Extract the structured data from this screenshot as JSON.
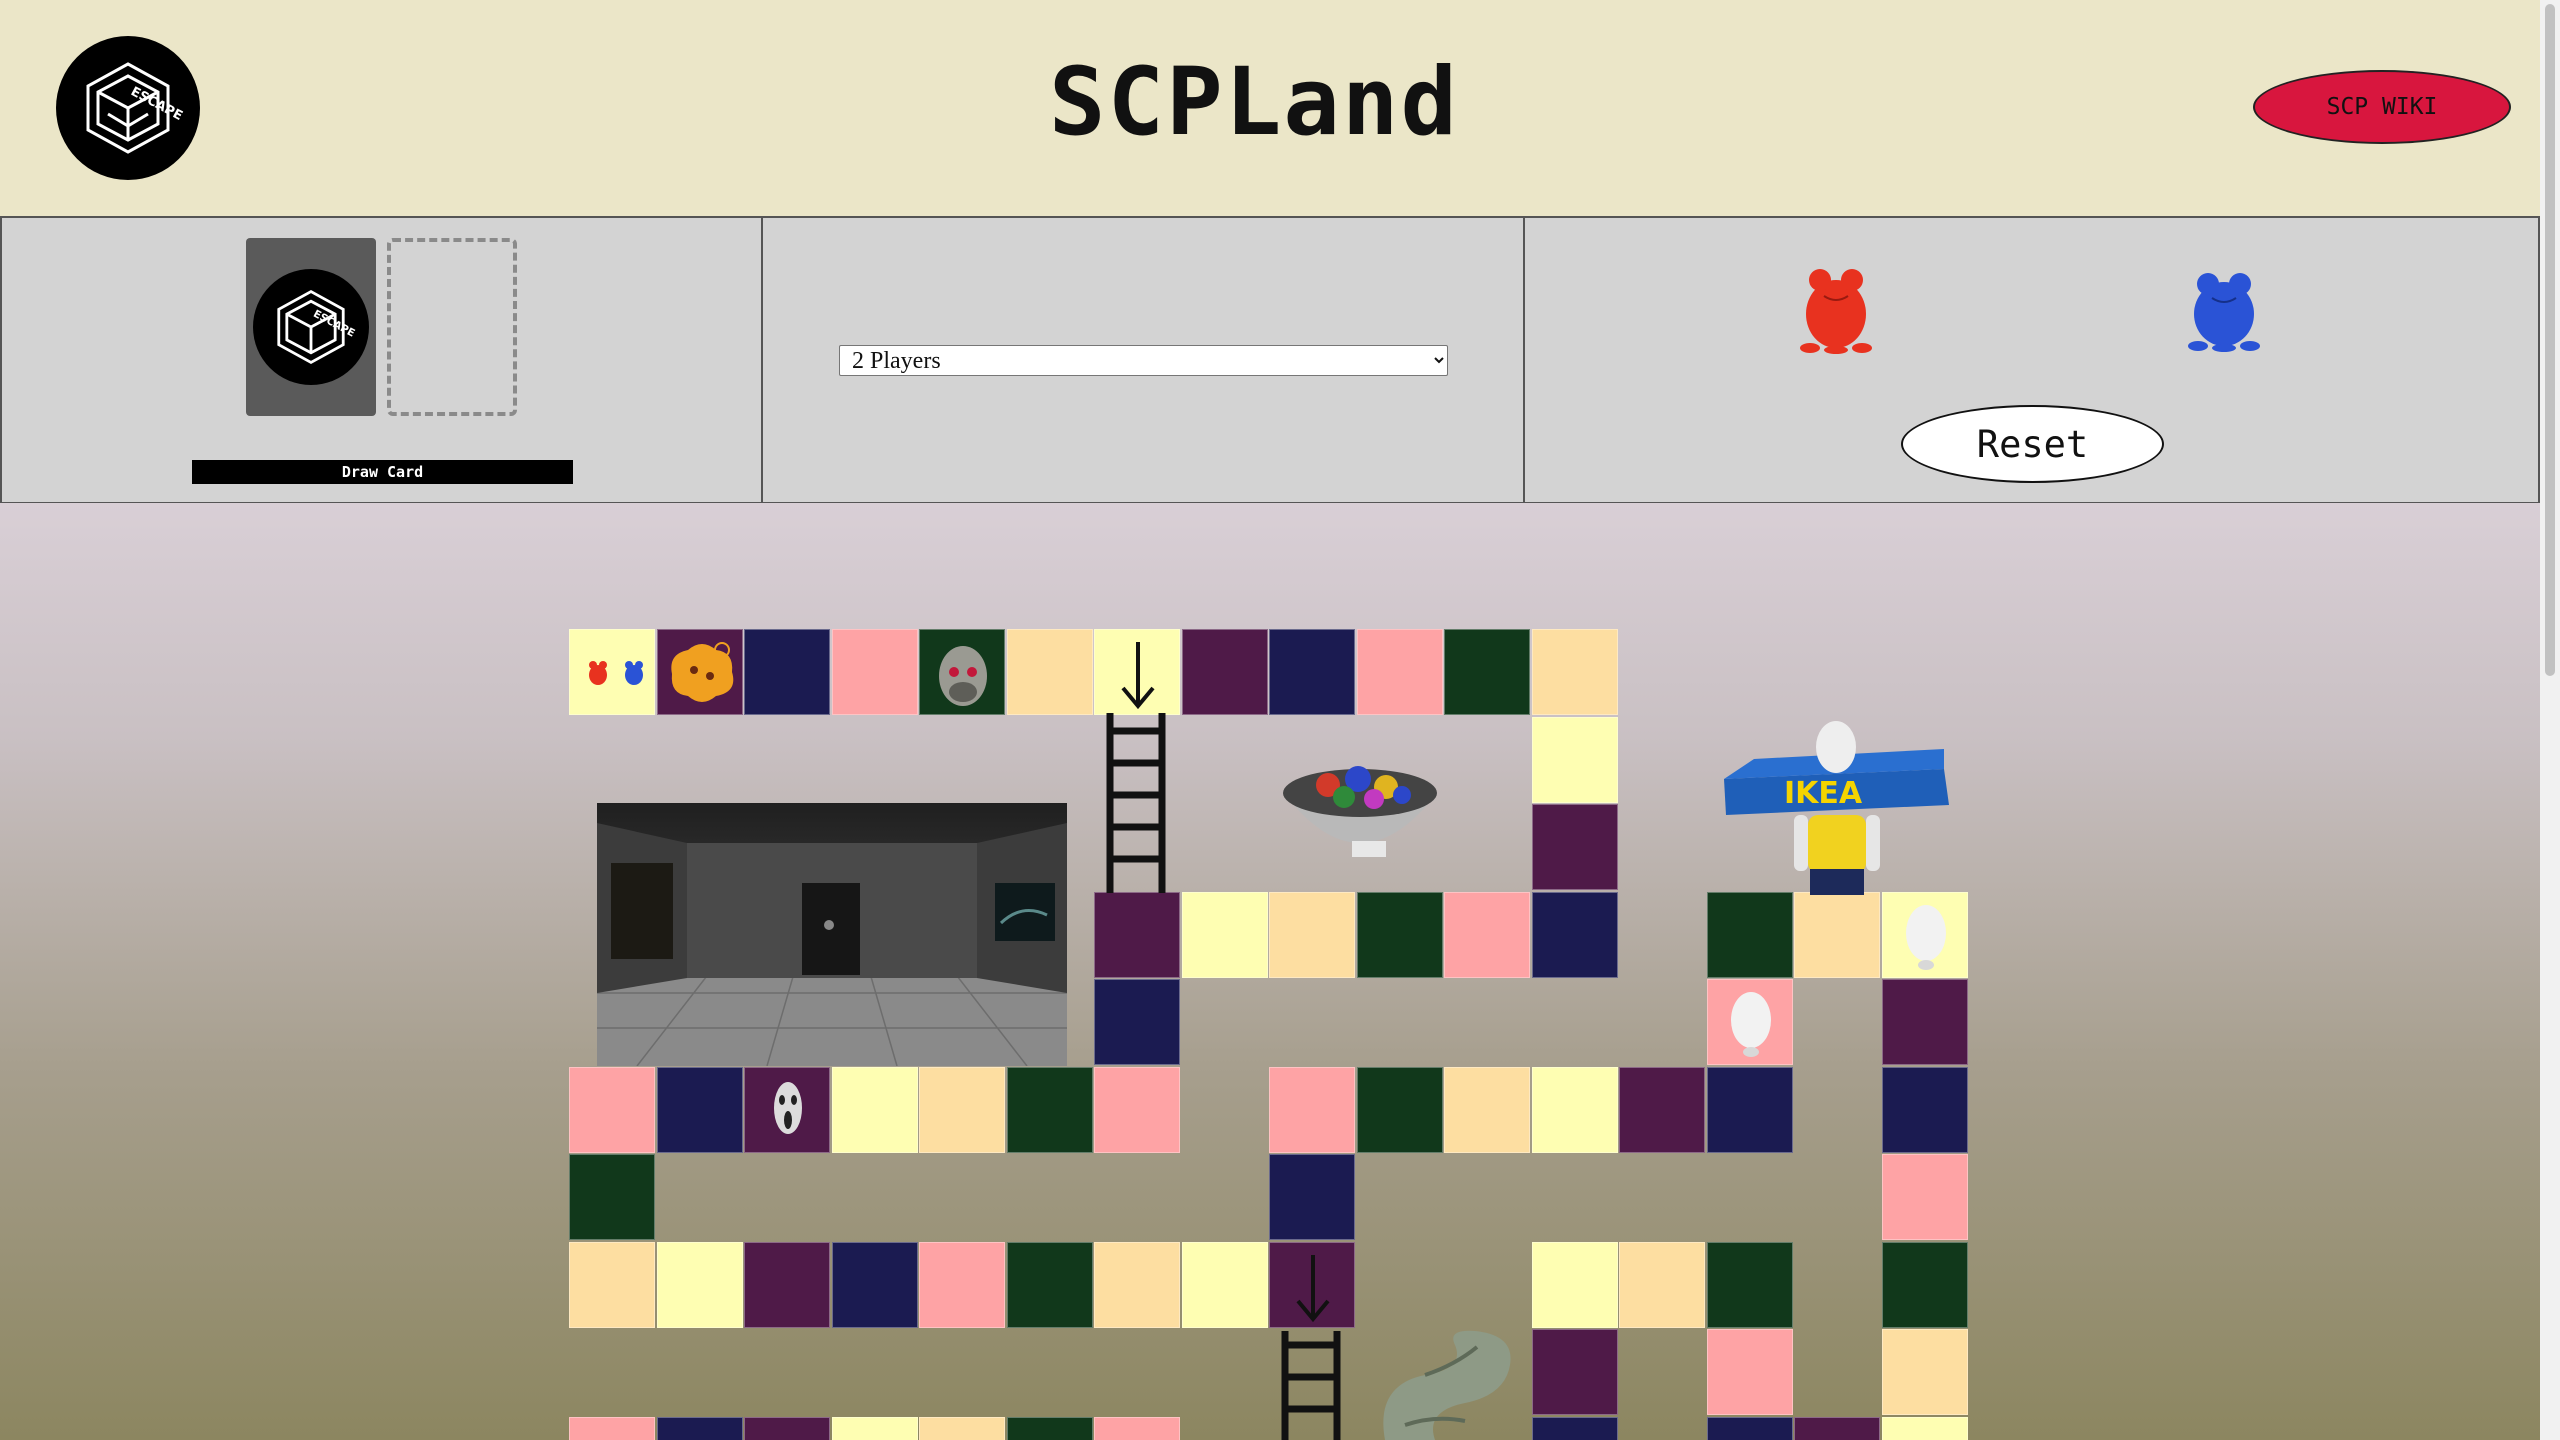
{
  "header": {
    "title": "SCPLand",
    "wiki_button": "SCP WIKI",
    "logo_text": "ESCAPE"
  },
  "cards": {
    "draw_button": "Draw Card"
  },
  "players": {
    "selected": "2 Players",
    "options": [
      "2 Players"
    ]
  },
  "tokens": {
    "players": [
      {
        "name": "red-player",
        "color": "#e8321f"
      },
      {
        "name": "blue-player",
        "color": "#2a53d6"
      }
    ],
    "reset_button": "Reset"
  },
  "colors": {
    "yellow": "#fefeb2",
    "peach": "#fddea1",
    "navy": "#1b1b51",
    "pink": "#fea3a5",
    "green": "#11381b",
    "purple": "#4f1a48",
    "wiki": "#d8163e"
  },
  "board": {
    "tiles": [
      {
        "col": 0,
        "row": 0,
        "color": "yellow",
        "content": "start-tokens"
      },
      {
        "col": 1,
        "row": 0,
        "color": "purple",
        "content": "orange-blob"
      },
      {
        "col": 2,
        "row": 0,
        "color": "navy"
      },
      {
        "col": 3,
        "row": 0,
        "color": "pink"
      },
      {
        "col": 4,
        "row": 0,
        "color": "green",
        "content": "reptile-head"
      },
      {
        "col": 5,
        "row": 0,
        "color": "peach"
      },
      {
        "col": 6,
        "row": 0,
        "color": "yellow",
        "content": "down-arrow"
      },
      {
        "col": 7,
        "row": 0,
        "color": "purple"
      },
      {
        "col": 8,
        "row": 0,
        "color": "navy"
      },
      {
        "col": 9,
        "row": 0,
        "color": "pink"
      },
      {
        "col": 10,
        "row": 0,
        "color": "green"
      },
      {
        "col": 11,
        "row": 0,
        "color": "peach"
      },
      {
        "col": 11,
        "row": 1,
        "color": "yellow"
      },
      {
        "col": 11,
        "row": 2,
        "color": "purple"
      },
      {
        "col": 11,
        "row": 3,
        "color": "navy"
      },
      {
        "col": 10,
        "row": 3,
        "color": "pink"
      },
      {
        "col": 9,
        "row": 3,
        "color": "green"
      },
      {
        "col": 8,
        "row": 3,
        "color": "peach"
      },
      {
        "col": 7,
        "row": 3,
        "color": "yellow"
      },
      {
        "col": 6,
        "row": 3,
        "color": "purple"
      },
      {
        "col": 6,
        "row": 4,
        "color": "navy"
      },
      {
        "col": 6,
        "row": 5,
        "color": "pink"
      },
      {
        "col": 5,
        "row": 5,
        "color": "green"
      },
      {
        "col": 4,
        "row": 5,
        "color": "peach"
      },
      {
        "col": 3,
        "row": 5,
        "color": "yellow"
      },
      {
        "col": 2,
        "row": 5,
        "color": "purple",
        "content": "scream-face"
      },
      {
        "col": 1,
        "row": 5,
        "color": "navy"
      },
      {
        "col": 0,
        "row": 5,
        "color": "pink"
      },
      {
        "col": 0,
        "row": 6,
        "color": "green"
      },
      {
        "col": 0,
        "row": 7,
        "color": "peach"
      },
      {
        "col": 1,
        "row": 7,
        "color": "yellow"
      },
      {
        "col": 2,
        "row": 7,
        "color": "purple"
      },
      {
        "col": 3,
        "row": 7,
        "color": "navy"
      },
      {
        "col": 4,
        "row": 7,
        "color": "pink"
      },
      {
        "col": 5,
        "row": 7,
        "color": "green"
      },
      {
        "col": 6,
        "row": 7,
        "color": "peach"
      },
      {
        "col": 7,
        "row": 7,
        "color": "yellow"
      },
      {
        "col": 8,
        "row": 7,
        "color": "purple",
        "content": "down-arrow"
      },
      {
        "col": 8,
        "row": 6,
        "color": "navy"
      },
      {
        "col": 8,
        "row": 5,
        "color": "pink"
      },
      {
        "col": 9,
        "row": 5,
        "color": "green"
      },
      {
        "col": 10,
        "row": 5,
        "color": "peach"
      },
      {
        "col": 11,
        "row": 5,
        "color": "yellow"
      },
      {
        "col": 12,
        "row": 5,
        "color": "purple"
      },
      {
        "col": 13,
        "row": 5,
        "color": "navy"
      },
      {
        "col": 13,
        "row": 4,
        "color": "pink",
        "content": "white-head"
      },
      {
        "col": 13,
        "row": 3,
        "color": "green"
      },
      {
        "col": 14,
        "row": 3,
        "color": "peach"
      },
      {
        "col": 15,
        "row": 3,
        "color": "yellow",
        "content": "white-head"
      },
      {
        "col": 15,
        "row": 4,
        "color": "purple"
      },
      {
        "col": 15,
        "row": 5,
        "color": "navy"
      },
      {
        "col": 15,
        "row": 6,
        "color": "pink"
      },
      {
        "col": 15,
        "row": 7,
        "color": "green"
      },
      {
        "col": 15,
        "row": 8,
        "color": "peach"
      },
      {
        "col": 15,
        "row": 9,
        "color": "yellow"
      },
      {
        "col": 14,
        "row": 9,
        "color": "purple"
      },
      {
        "col": 13,
        "row": 9,
        "color": "navy"
      },
      {
        "col": 13,
        "row": 8,
        "color": "pink"
      },
      {
        "col": 13,
        "row": 7,
        "color": "green"
      },
      {
        "col": 12,
        "row": 7,
        "color": "peach"
      },
      {
        "col": 11,
        "row": 7,
        "color": "yellow"
      },
      {
        "col": 11,
        "row": 8,
        "color": "purple"
      },
      {
        "col": 11,
        "row": 9,
        "color": "navy"
      },
      {
        "col": 0,
        "row": 9,
        "color": "pink"
      },
      {
        "col": 1,
        "row": 9,
        "color": "navy"
      },
      {
        "col": 2,
        "row": 9,
        "color": "purple"
      },
      {
        "col": 3,
        "row": 9,
        "color": "yellow"
      },
      {
        "col": 4,
        "row": 9,
        "color": "peach"
      },
      {
        "col": 5,
        "row": 9,
        "color": "green"
      },
      {
        "col": 6,
        "row": 9,
        "color": "pink"
      }
    ],
    "decorations": [
      "ladder",
      "ladder",
      "room-photo",
      "candy-bowl",
      "ikea-figure",
      "serpent-statue"
    ]
  }
}
